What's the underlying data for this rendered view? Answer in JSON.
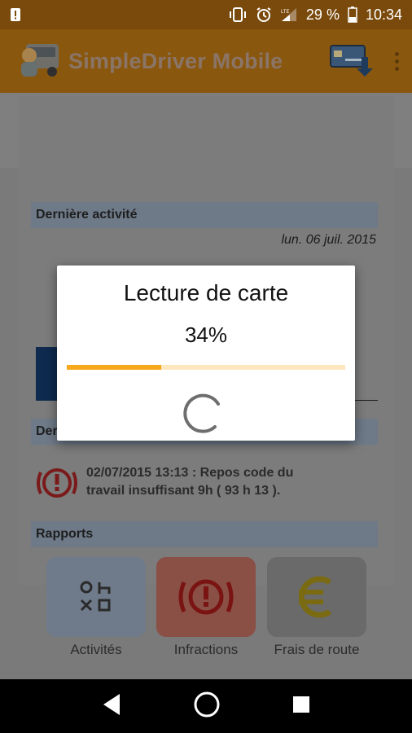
{
  "status_bar": {
    "battery_percent": "29 %",
    "time": "10:34",
    "network": "LTE"
  },
  "app_bar": {
    "title": "SimpleDriver Mobile"
  },
  "activity": {
    "header": "Dernière activité",
    "date": "lun. 06 juil. 2015"
  },
  "infractions": {
    "header_visible_prefix": "Der",
    "message_line1": "02/07/2015 13:13 : Repos code du",
    "message_line2": "travail insuffisant 9h ( 93 h 13 )."
  },
  "reports": {
    "header": "Rapports",
    "items": [
      {
        "label": "Activités",
        "icon": "activities-icon",
        "bg": "#6f7b8a"
      },
      {
        "label": "Infractions",
        "icon": "infraction-alert-icon",
        "bg": "#8a4f45"
      },
      {
        "label": "Frais de route",
        "icon": "euro-icon",
        "bg": "#6a6a6a"
      }
    ]
  },
  "modal": {
    "title": "Lecture de carte",
    "percent_text": "34%",
    "progress": 0.34
  },
  "colors": {
    "accent": "#f8a81b",
    "app_bar": "#8a570f",
    "status_bar": "#7a4a0c"
  }
}
